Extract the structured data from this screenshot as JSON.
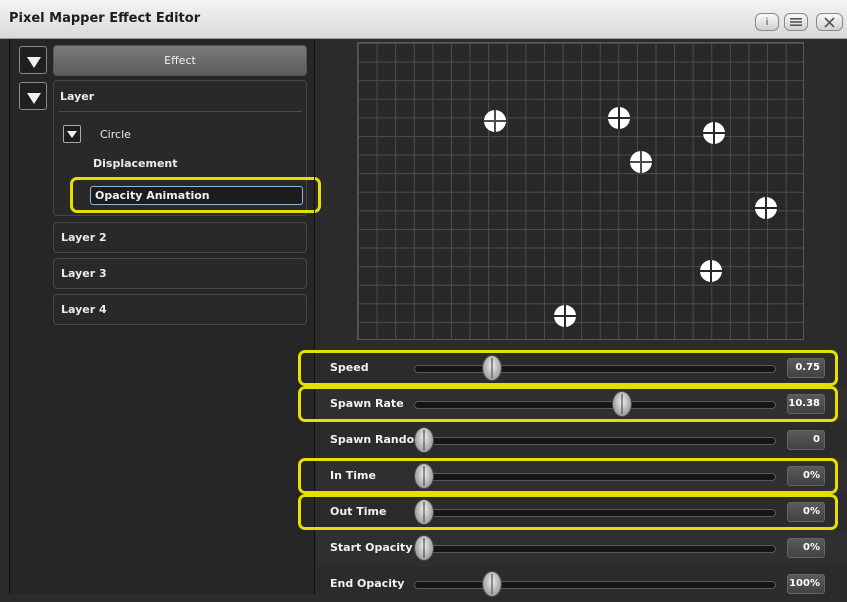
{
  "window": {
    "title": "Pixel Mapper Effect Editor",
    "info_button": "i",
    "menu_icon": "menu-icon",
    "close_icon": "close-icon"
  },
  "tree": {
    "effect_label": "Effect",
    "layer_label": "Layer",
    "circle_label": "Circle",
    "displacement_label": "Displacement",
    "opacity_animation_label": "Opacity Animation",
    "layers": [
      "Layer 2",
      "Layer 3",
      "Layer 4"
    ]
  },
  "params": [
    {
      "label": "Speed",
      "value": "0.75",
      "slider": 0.2,
      "highlighted": true
    },
    {
      "label": "Spawn Rate",
      "value": "10.38",
      "slider": 0.58,
      "highlighted": true
    },
    {
      "label": "Spawn Random",
      "value": "0",
      "slider": 0.0,
      "highlighted": false
    },
    {
      "label": "In Time",
      "value": "0%",
      "slider": 0.0,
      "highlighted": true
    },
    {
      "label": "Out Time",
      "value": "0%",
      "slider": 0.0,
      "highlighted": true
    },
    {
      "label": "Start Opacity",
      "value": "0%",
      "slider": 0.0,
      "highlighted": false
    },
    {
      "label": "End Opacity",
      "value": "100%",
      "slider": 0.2,
      "highlighted": false
    }
  ],
  "colors": {
    "highlight": "#e6e000",
    "background": "#2b2b2b"
  }
}
